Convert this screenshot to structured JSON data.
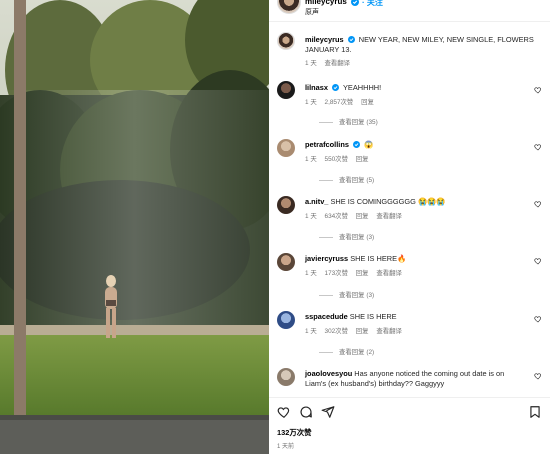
{
  "header": {
    "username": "mileycyrus",
    "follow_label": "· 关注",
    "subtitle": "原声"
  },
  "caption": {
    "username": "mileycyrus",
    "text": "NEW YEAR, NEW MILEY, NEW SINGLE, FLOWERS JANUARY 13.",
    "time": "1 天",
    "translate": "查看翻译"
  },
  "comments": [
    {
      "username": "lilnasx",
      "verified": true,
      "text": "YEAHHHH!",
      "time": "1 天",
      "likes": "2,857次赞",
      "reply": "回复",
      "translate": "",
      "replies": "查看回复 (35)"
    },
    {
      "username": "petrafcollins",
      "verified": true,
      "text": "😱",
      "time": "1 天",
      "likes": "550次赞",
      "reply": "回复",
      "translate": "",
      "replies": "查看回复 (5)"
    },
    {
      "username": "a.nitv_",
      "verified": false,
      "text": "SHE IS COMINGGGGGG 😭😭😭",
      "time": "1 天",
      "likes": "634次赞",
      "reply": "回复",
      "translate": "查看翻译",
      "replies": "查看回复 (3)"
    },
    {
      "username": "javiercyruss",
      "verified": false,
      "text": "SHE IS HERE🔥",
      "time": "1 天",
      "likes": "173次赞",
      "reply": "回复",
      "translate": "查看翻译",
      "replies": "查看回复 (3)"
    },
    {
      "username": "sspacedude",
      "verified": false,
      "text": "SHE IS HERE",
      "time": "1 天",
      "likes": "302次赞",
      "reply": "回复",
      "translate": "查看翻译",
      "replies": "查看回复 (2)"
    },
    {
      "username": "joaolovesyou",
      "verified": false,
      "text": "Has anyone noticed the coming out date is on",
      "text2": "Liam's (ex husband's) birthday?? Gaggyyy",
      "time": "",
      "likes": "",
      "reply": "",
      "translate": "",
      "replies": ""
    }
  ],
  "footer": {
    "likes": "132万次赞",
    "posted": "1 天前"
  },
  "icons": {
    "heart": "heart-icon",
    "comment": "comment-icon",
    "share": "send-icon",
    "save": "bookmark-icon",
    "verified": "verified-badge-icon"
  },
  "colors": {
    "accent": "#0095f6",
    "muted": "#737373"
  }
}
